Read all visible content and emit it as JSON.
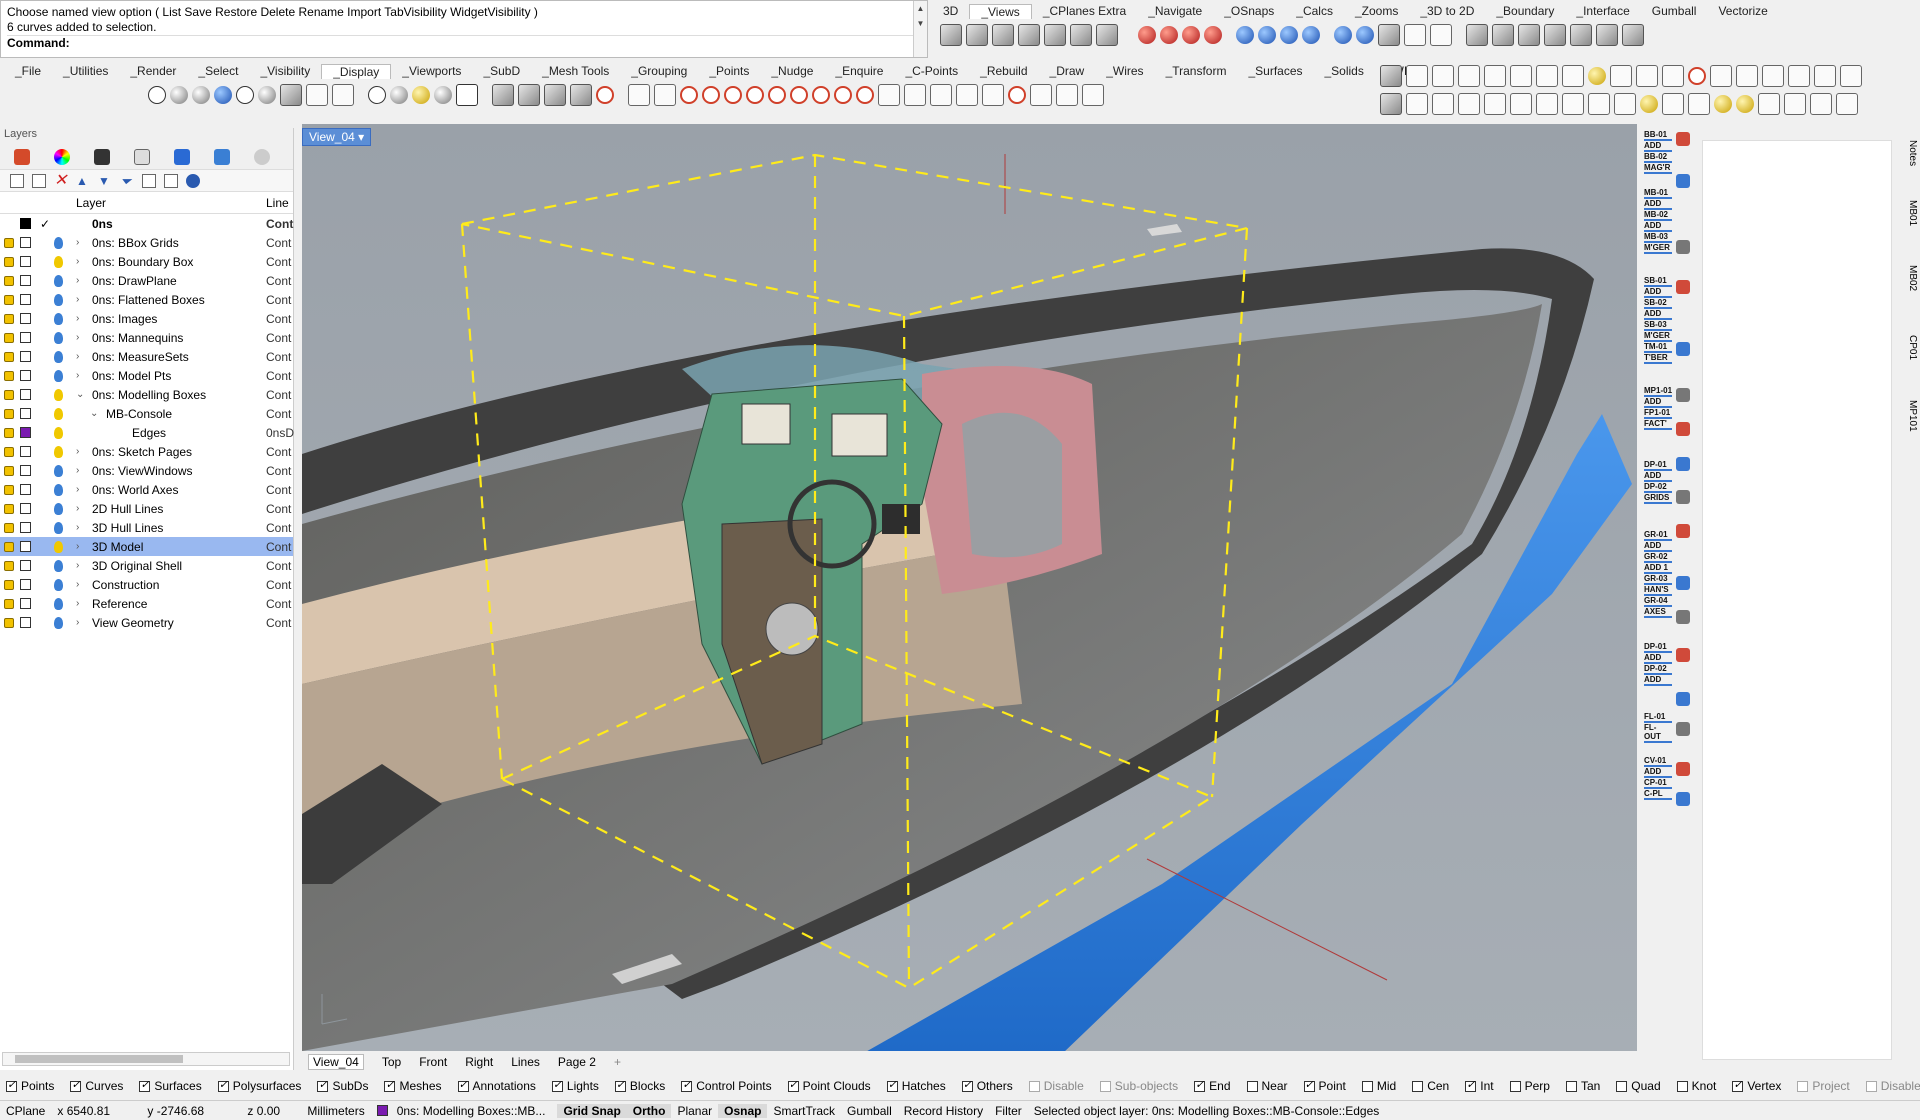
{
  "command": {
    "line1": "Choose named view option ( List  Save  Restore  Delete  Rename  Import  TabVisibility  WidgetVisibility )",
    "line2": "6 curves added to selection.",
    "prompt": "Command:"
  },
  "toolbar_top": {
    "tabs": [
      "3D",
      "_Views",
      "_CPlanes Extra",
      "_Navigate",
      "_OSnaps",
      "_Calcs",
      "_Zooms",
      "_3D to 2D",
      "_Boundary",
      "_Interface",
      "Gumball",
      "Vectorize"
    ],
    "active_tab": "_Views"
  },
  "toolbar_main": {
    "tabs": [
      "_File",
      "_Utilities",
      "_Render",
      "_Select",
      "_Visibility",
      "_Display",
      "_Viewports",
      "_SubD",
      "_Mesh Tools",
      "_Grouping",
      "_Points",
      "_Nudge",
      "_Enquire",
      "_C-Points",
      "_Rebuild",
      "_Draw",
      "_Wires",
      "_Transform",
      "_Surfaces",
      "_Solids",
      "_WIP"
    ],
    "active_tab": "_Display"
  },
  "layers": {
    "panel_title": "Layers",
    "columns": {
      "layer": "Layer",
      "linetype": "Line"
    },
    "current": {
      "name": "0ns",
      "linetype": "Cont"
    },
    "rows": [
      {
        "name": "0ns: BBox Grids",
        "linetype": "Cont",
        "arrow": "›",
        "indent": 0,
        "color": "#ffffff",
        "bulb": "#3b7fd4"
      },
      {
        "name": "0ns: Boundary Box",
        "linetype": "Cont",
        "arrow": "›",
        "indent": 0,
        "color": "#ffffff",
        "bulb": "#f0c800"
      },
      {
        "name": "0ns: DrawPlane",
        "linetype": "Cont",
        "arrow": "›",
        "indent": 0,
        "color": "#ffffff",
        "bulb": "#3b7fd4"
      },
      {
        "name": "0ns: Flattened Boxes",
        "linetype": "Cont",
        "arrow": "›",
        "indent": 0,
        "color": "#ffffff",
        "bulb": "#3b7fd4"
      },
      {
        "name": "0ns: Images",
        "linetype": "Cont",
        "arrow": "›",
        "indent": 0,
        "color": "#ffffff",
        "bulb": "#3b7fd4"
      },
      {
        "name": "0ns: Mannequins",
        "linetype": "Cont",
        "arrow": "›",
        "indent": 0,
        "color": "#ffffff",
        "bulb": "#3b7fd4"
      },
      {
        "name": "0ns: MeasureSets",
        "linetype": "Cont",
        "arrow": "›",
        "indent": 0,
        "color": "#ffffff",
        "bulb": "#3b7fd4"
      },
      {
        "name": "0ns: Model Pts",
        "linetype": "Cont",
        "arrow": "›",
        "indent": 0,
        "color": "#ffffff",
        "bulb": "#3b7fd4"
      },
      {
        "name": "0ns: Modelling Boxes",
        "linetype": "Cont",
        "arrow": "⌄",
        "indent": 0,
        "color": "#ffffff",
        "bulb": "#f0c800"
      },
      {
        "name": "MB-Console",
        "linetype": "Cont",
        "arrow": "⌄",
        "indent": 1,
        "color": "#ffffff",
        "bulb": "#f0c800"
      },
      {
        "name": "Edges",
        "linetype": "0nsD",
        "arrow": "",
        "indent": 2,
        "color": "#7a1bb0",
        "bulb": "#f0c800"
      },
      {
        "name": "0ns: Sketch Pages",
        "linetype": "Cont",
        "arrow": "›",
        "indent": 0,
        "color": "#ffffff",
        "bulb": "#f0c800"
      },
      {
        "name": "0ns: ViewWindows",
        "linetype": "Cont",
        "arrow": "›",
        "indent": 0,
        "color": "#ffffff",
        "bulb": "#3b7fd4"
      },
      {
        "name": "0ns: World Axes",
        "linetype": "Cont",
        "arrow": "›",
        "indent": 0,
        "color": "#ffffff",
        "bulb": "#3b7fd4"
      },
      {
        "name": "2D Hull Lines",
        "linetype": "Cont",
        "arrow": "›",
        "indent": 0,
        "color": "#ffffff",
        "bulb": "#3b7fd4"
      },
      {
        "name": "3D Hull Lines",
        "linetype": "Cont",
        "arrow": "›",
        "indent": 0,
        "color": "#ffffff",
        "bulb": "#3b7fd4"
      },
      {
        "name": "3D Model",
        "linetype": "Cont",
        "arrow": "›",
        "indent": 0,
        "color": "#ffffff",
        "bulb": "#f0c800",
        "selected": true
      },
      {
        "name": "3D Original Shell",
        "linetype": "Cont",
        "arrow": "›",
        "indent": 0,
        "color": "#ffffff",
        "bulb": "#3b7fd4"
      },
      {
        "name": "Construction",
        "linetype": "Cont",
        "arrow": "›",
        "indent": 0,
        "color": "#ffffff",
        "bulb": "#3b7fd4"
      },
      {
        "name": "Reference",
        "linetype": "Cont",
        "arrow": "›",
        "indent": 0,
        "color": "#ffffff",
        "bulb": "#3b7fd4"
      },
      {
        "name": "View Geometry",
        "linetype": "Cont",
        "arrow": "›",
        "indent": 0,
        "color": "#ffffff",
        "bulb": "#3b7fd4"
      }
    ]
  },
  "viewport": {
    "title": "View_04",
    "tabs": [
      "View_04",
      "Top",
      "Front",
      "Right",
      "Lines",
      "Page 2"
    ],
    "active_tab": "View_04",
    "add_tab": "+"
  },
  "right_strip": [
    {
      "l1": "BB-01",
      "l2": "ADD"
    },
    {
      "l1": "BB-02",
      "l2": "MAG'R"
    },
    {
      "l1": "MB-01",
      "l2": "ADD"
    },
    {
      "l1": "MB-02",
      "l2": "ADD"
    },
    {
      "l1": "MB-03",
      "l2": "M'GER"
    },
    {
      "l1": "SB-01",
      "l2": "ADD"
    },
    {
      "l1": "SB-02",
      "l2": "ADD"
    },
    {
      "l1": "SB-03",
      "l2": "M'GER"
    },
    {
      "l1": "TM-01",
      "l2": "T'BER"
    },
    {
      "l1": "MP1-01",
      "l2": "ADD"
    },
    {
      "l1": "FP1-01",
      "l2": "FACT'"
    },
    {
      "l1": "DP-01",
      "l2": "ADD"
    },
    {
      "l1": "DP-02",
      "l2": "GRIDS"
    },
    {
      "l1": "GR-01",
      "l2": "ADD"
    },
    {
      "l1": "GR-02",
      "l2": "ADD 1"
    },
    {
      "l1": "GR-03",
      "l2": "HAN'S"
    },
    {
      "l1": "GR-04",
      "l2": "AXES"
    },
    {
      "l1": "DP-01",
      "l2": "ADD"
    },
    {
      "l1": "DP-02",
      "l2": "ADD"
    },
    {
      "l1": "FL-01",
      "l2": "FL-OUT"
    },
    {
      "l1": "CV-01",
      "l2": "ADD"
    },
    {
      "l1": "CP-01",
      "l2": "C-PL"
    }
  ],
  "side_tabs": [
    "Notes",
    "MB01",
    "MB02",
    "CP01",
    "MP101"
  ],
  "osnap_left": [
    {
      "label": "Points",
      "checked": true,
      "disabled": false
    },
    {
      "label": "Curves",
      "checked": true,
      "disabled": false
    },
    {
      "label": "Surfaces",
      "checked": true,
      "disabled": false
    },
    {
      "label": "Polysurfaces",
      "checked": true,
      "disabled": false
    },
    {
      "label": "SubDs",
      "checked": true,
      "disabled": false
    },
    {
      "label": "Meshes",
      "checked": true,
      "disabled": false
    },
    {
      "label": "Annotations",
      "checked": true,
      "disabled": false
    },
    {
      "label": "Lights",
      "checked": true,
      "disabled": false
    },
    {
      "label": "Blocks",
      "checked": true,
      "disabled": false
    },
    {
      "label": "Control Points",
      "checked": true,
      "disabled": false
    },
    {
      "label": "Point Clouds",
      "checked": true,
      "disabled": false
    },
    {
      "label": "Hatches",
      "checked": true,
      "disabled": false
    },
    {
      "label": "Others",
      "checked": true,
      "disabled": false
    },
    {
      "label": "Disable",
      "checked": false,
      "disabled": true
    },
    {
      "label": "Sub-objects",
      "checked": false,
      "disabled": true
    }
  ],
  "osnap_right": [
    {
      "label": "End",
      "checked": true,
      "disabled": false
    },
    {
      "label": "Near",
      "checked": false,
      "disabled": false
    },
    {
      "label": "Point",
      "checked": true,
      "disabled": false
    },
    {
      "label": "Mid",
      "checked": false,
      "disabled": false
    },
    {
      "label": "Cen",
      "checked": false,
      "disabled": false
    },
    {
      "label": "Int",
      "checked": true,
      "disabled": false
    },
    {
      "label": "Perp",
      "checked": false,
      "disabled": false
    },
    {
      "label": "Tan",
      "checked": false,
      "disabled": false
    },
    {
      "label": "Quad",
      "checked": false,
      "disabled": false
    },
    {
      "label": "Knot",
      "checked": false,
      "disabled": false
    },
    {
      "label": "Vertex",
      "checked": true,
      "disabled": false
    },
    {
      "label": "Project",
      "checked": false,
      "disabled": true
    },
    {
      "label": "Disable",
      "checked": false,
      "disabled": true
    }
  ],
  "status": {
    "cplane": "CPlane",
    "x": "x 6540.81",
    "y": "y -2746.68",
    "z": "z 0.00",
    "units": "Millimeters",
    "layer": "0ns: Modelling Boxes::MB...",
    "grid_snap": "Grid Snap",
    "ortho": "Ortho",
    "planar": "Planar",
    "osnap": "Osnap",
    "smarttrack": "SmartTrack",
    "gumball": "Gumball",
    "record_history": "Record History",
    "filter": "Filter",
    "message": "Selected object layer: 0ns: Modelling Boxes::MB-Console::Edges"
  },
  "colors": {
    "viewport_bg": "#9aa3ac",
    "hull_blue": "#2f7fd6",
    "selection_yellow": "#ffeb1a",
    "console_green": "#4f9a78",
    "layer_selected": "#99b8f0"
  }
}
